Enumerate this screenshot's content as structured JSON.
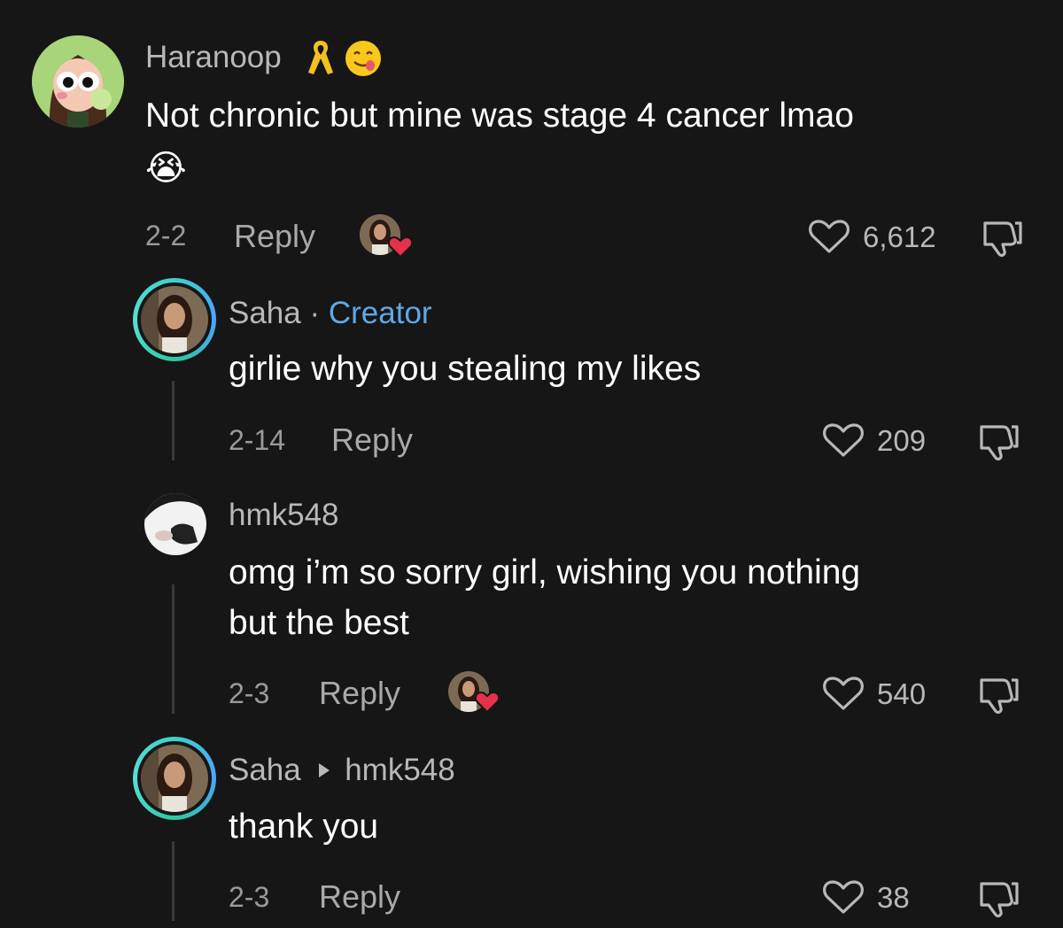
{
  "comments": [
    {
      "username": "Haranoop",
      "text_line1": "Not chronic but mine was stage 4 cancer lmao",
      "emoji": "😭",
      "date": "2-2",
      "reply_label": "Reply",
      "likes": "6,612"
    },
    {
      "username": "Saha",
      "separator": "·",
      "badge": "Creator",
      "text_line1": "girlie why you stealing my likes",
      "date": "2-14",
      "reply_label": "Reply",
      "likes": "209"
    },
    {
      "username": "hmk548",
      "text_line1": "omg i’m so sorry girl, wishing you nothing",
      "text_line2": "but the best",
      "date": "2-3",
      "reply_label": "Reply",
      "likes": "540"
    },
    {
      "username": "Saha",
      "reply_to": "hmk548",
      "text_line1": "thank you",
      "date": "2-3",
      "reply_label": "Reply",
      "likes": "38"
    }
  ],
  "colors": {
    "background": "#161616",
    "creator_badge": "#5fa8e6",
    "heart_badge": "#e8304a"
  }
}
